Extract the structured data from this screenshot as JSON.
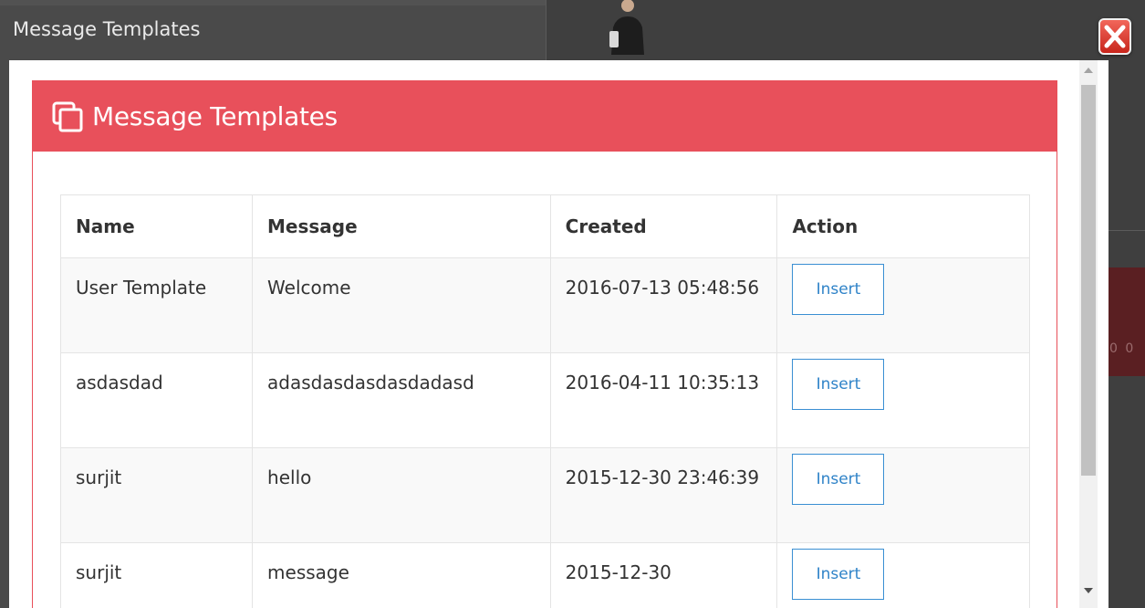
{
  "window": {
    "title": "Message Templates"
  },
  "panel": {
    "title": "Message Templates",
    "accent_color": "#e8505b"
  },
  "table": {
    "headers": [
      "Name",
      "Message",
      "Created",
      "Action"
    ],
    "rows": [
      {
        "name": "User Template",
        "message": "Welcome",
        "created": "2016-07-13 05:48:56",
        "action": "Insert"
      },
      {
        "name": "asdasdad",
        "message": "adasdasdasdasdadasd",
        "created": "2016-04-11 10:35:13",
        "action": "Insert"
      },
      {
        "name": "surjit",
        "message": "hello",
        "created": "2015-12-30 23:46:39",
        "action": "Insert"
      },
      {
        "name": "surjit",
        "message": "message",
        "created": "2015-12-30",
        "action": "Insert"
      }
    ]
  },
  "background": {
    "partial_text": "0 0"
  },
  "icons": {
    "header_icon": "copy-icon",
    "close_icon": "close-icon"
  }
}
